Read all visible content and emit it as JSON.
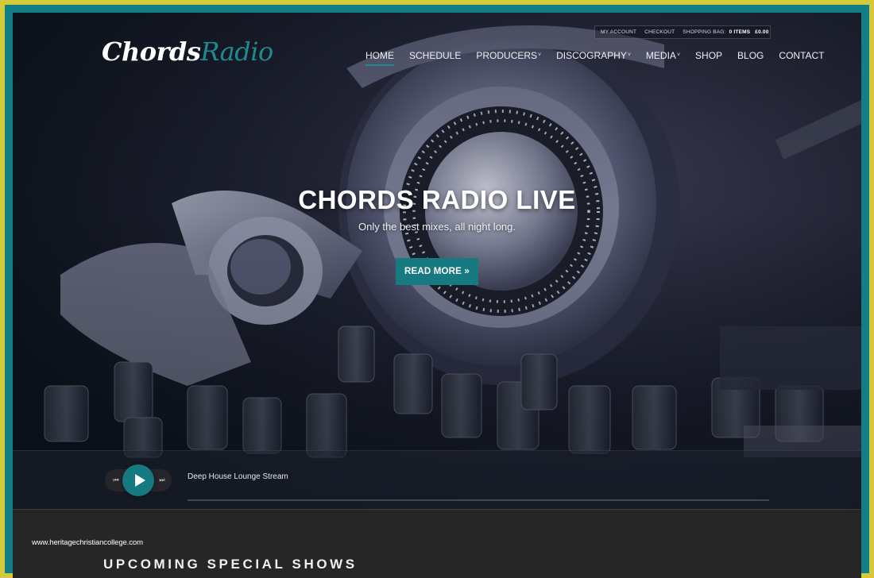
{
  "site": {
    "logo_part1": "Chords",
    "logo_part2": "Radio"
  },
  "topbar": {
    "my_account": "MY ACCOUNT",
    "checkout": "CHECKOUT",
    "shopping_bag_label": "SHOPPING BAG:",
    "items": "0 ITEMS",
    "total": "£0.00"
  },
  "nav": {
    "items": [
      {
        "label": "HOME",
        "active": true,
        "dropdown": false
      },
      {
        "label": "SCHEDULE",
        "active": false,
        "dropdown": false
      },
      {
        "label": "PRODUCERS",
        "active": false,
        "dropdown": true
      },
      {
        "label": "DISCOGRAPHY",
        "active": false,
        "dropdown": true
      },
      {
        "label": "MEDIA",
        "active": false,
        "dropdown": true
      },
      {
        "label": "SHOP",
        "active": false,
        "dropdown": false
      },
      {
        "label": "BLOG",
        "active": false,
        "dropdown": false
      },
      {
        "label": "CONTACT",
        "active": false,
        "dropdown": false
      }
    ],
    "caret_glyph": "˅"
  },
  "hero": {
    "title": "CHORDS RADIO LIVE",
    "subtitle": "Only the best mixes, all night long.",
    "cta_label": "READ MORE »"
  },
  "player": {
    "prev_icon": "⏮",
    "next_icon": "⏭",
    "stream_title": "Deep House Lounge Stream",
    "progress_percent": 0
  },
  "lower": {
    "watermark": "www.heritagechristiancollege.com",
    "section_title": "UPCOMING SPECIAL SHOWS"
  },
  "colors": {
    "accent": "#167a80",
    "frame_outer": "#d4c93c",
    "frame_inner": "#127f86",
    "section_bg": "#262626"
  }
}
